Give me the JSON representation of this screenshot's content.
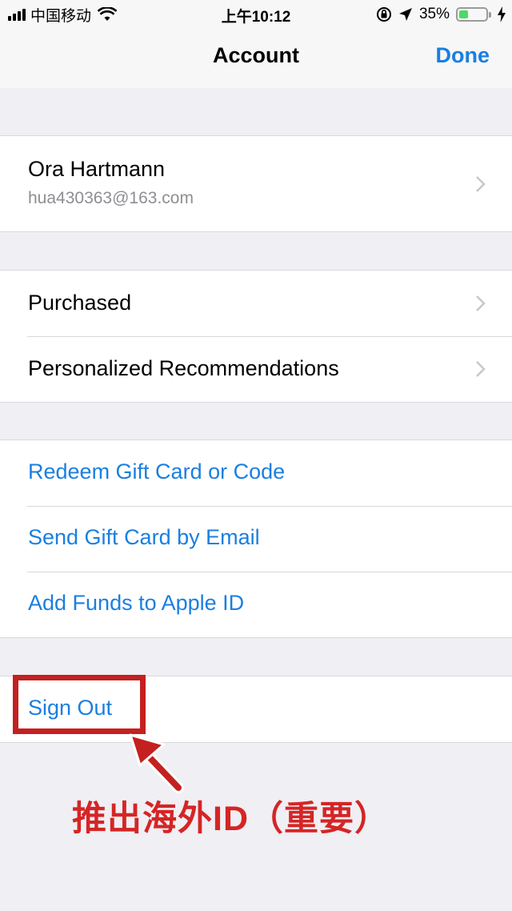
{
  "status_bar": {
    "carrier": "中国移动",
    "time": "上午10:12",
    "battery_percent_text": "35%",
    "battery_level": 0.35
  },
  "nav": {
    "title": "Account",
    "done_label": "Done"
  },
  "account": {
    "name": "Ora Hartmann",
    "email": "hua430363@163.com"
  },
  "section_store": {
    "items": [
      {
        "label": "Purchased"
      },
      {
        "label": "Personalized Recommendations"
      }
    ]
  },
  "section_gifts": {
    "items": [
      {
        "label": "Redeem Gift Card or Code"
      },
      {
        "label": "Send Gift Card by Email"
      },
      {
        "label": "Add Funds to Apple ID"
      }
    ]
  },
  "sign_out": {
    "label": "Sign Out"
  },
  "annotation": {
    "text": "推出海外ID（重要）"
  },
  "colors": {
    "accent": "#1a7fe0",
    "annotation": "#d52525",
    "background": "#efeff4"
  }
}
